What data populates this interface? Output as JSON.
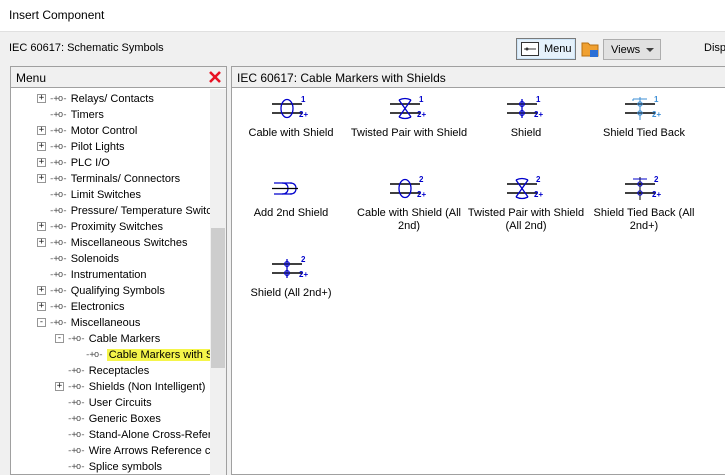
{
  "window": {
    "title": "Insert Component"
  },
  "toolbar": {
    "breadcrumb": "IEC 60617: Schematic Symbols",
    "menu_label": "Menu",
    "views_label": "Views",
    "disp_label": "Disp"
  },
  "left_panel": {
    "title": "Menu"
  },
  "tree": [
    {
      "label": "Relays/ Contacts",
      "expander": "+"
    },
    {
      "label": "Timers",
      "expander": ""
    },
    {
      "label": "Motor Control",
      "expander": "+"
    },
    {
      "label": "Pilot Lights",
      "expander": "+"
    },
    {
      "label": "PLC I/O",
      "expander": "+"
    },
    {
      "label": "Terminals/ Connectors",
      "expander": "+"
    },
    {
      "label": "Limit Switches",
      "expander": ""
    },
    {
      "label": "Pressure/ Temperature Switc",
      "expander": ""
    },
    {
      "label": "Proximity Switches",
      "expander": "+"
    },
    {
      "label": "Miscellaneous Switches",
      "expander": "+"
    },
    {
      "label": "Solenoids",
      "expander": ""
    },
    {
      "label": "Instrumentation",
      "expander": ""
    },
    {
      "label": "Qualifying Symbols",
      "expander": "+"
    },
    {
      "label": "Electronics",
      "expander": "+"
    },
    {
      "label": "Miscellaneous",
      "expander": "-"
    },
    {
      "label": "Cable Markers",
      "expander": "-"
    },
    {
      "label": "Cable Markers with S",
      "expander": "",
      "selected": true
    },
    {
      "label": "Receptacles",
      "expander": ""
    },
    {
      "label": "Shields (Non Intelligent)",
      "expander": "+"
    },
    {
      "label": "User Circuits",
      "expander": ""
    },
    {
      "label": "Generic Boxes",
      "expander": ""
    },
    {
      "label": "Stand-Alone Cross-Refer",
      "expander": ""
    },
    {
      "label": "Wire Arrows Reference c",
      "expander": ""
    },
    {
      "label": "Splice symbols",
      "expander": ""
    }
  ],
  "right_panel": {
    "title": "IEC 60617: Cable Markers with Shields"
  },
  "components": [
    {
      "label": "Cable with Shield",
      "icon": "cable-with-shield-icon",
      "n1": "1",
      "n2": "2+"
    },
    {
      "label": "Twisted Pair with Shield",
      "icon": "twisted-pair-shield-icon",
      "n1": "1",
      "n2": "2+"
    },
    {
      "label": "Shield",
      "icon": "shield-icon",
      "n1": "1",
      "n2": "2+"
    },
    {
      "label": "Shield Tied Back",
      "icon": "shield-tied-back-icon",
      "n1": "1",
      "n2": "2+"
    },
    {
      "label": "Add 2nd Shield",
      "icon": "add-2nd-shield-icon",
      "n1": "",
      "n2": ""
    },
    {
      "label": "Cable with Shield (All 2nd)",
      "icon": "cable-with-shield-all-2nd-icon",
      "n1": "2",
      "n2": "2+"
    },
    {
      "label": "Twisted Pair with Shield (All 2nd)",
      "icon": "twisted-pair-shield-all-2nd-icon",
      "n1": "2",
      "n2": "2+"
    },
    {
      "label": "Shield Tied Back (All 2nd+)",
      "icon": "shield-tied-back-all-2nd-icon",
      "n1": "2",
      "n2": "2+"
    },
    {
      "label": "Shield (All 2nd+)",
      "icon": "shield-all-2nd-icon",
      "n1": "2",
      "n2": "2+"
    }
  ],
  "colors": {
    "symbol_blue": "#0000cc",
    "tied_back_blue": "#3d8fd6",
    "selection_yellow": "#f5f54a",
    "close_red": "#e81123"
  }
}
